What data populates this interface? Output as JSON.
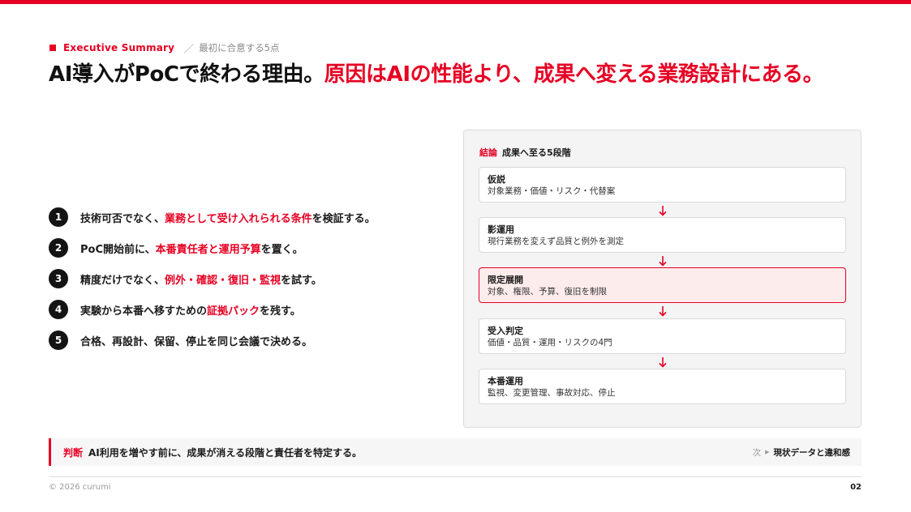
{
  "eyebrow": {
    "label": "Executive Summary",
    "separator": "／",
    "sub": "最初に合意する5点"
  },
  "title": {
    "plain": "AI導入がPoCで終わる理由。",
    "accent": "原因はAIの性能より、成果へ変える業務設計にある。"
  },
  "points": [
    {
      "num": "1",
      "pre": "技術可否でなく、",
      "hl": "業務として受け入れられる条件",
      "post": "を検証する。"
    },
    {
      "num": "2",
      "pre": "PoC開始前に、",
      "hl": "本番責任者と運用予算",
      "post": "を置く。"
    },
    {
      "num": "3",
      "pre": "精度だけでなく、",
      "hl": "例外・確認・復旧・監視",
      "post": "を試す。"
    },
    {
      "num": "4",
      "pre": "実験から本番へ移すための",
      "hl": "証拠パック",
      "post": "を残す。"
    },
    {
      "num": "5",
      "pre": "合格、再設計、保留、停止を同じ会議で決める。",
      "hl": "",
      "post": ""
    }
  ],
  "panel": {
    "tag": "結論",
    "title": "成果へ至る5段階",
    "steps": [
      {
        "name": "仮説",
        "desc": "対象業務・価値・リスク・代替案",
        "active": false
      },
      {
        "name": "影運用",
        "desc": "現行業務を変えず品質と例外を測定",
        "active": false
      },
      {
        "name": "限定展開",
        "desc": "対象、権限、予算、復旧を制限",
        "active": true
      },
      {
        "name": "受入判定",
        "desc": "価値・品質・運用・リスクの4門",
        "active": false
      },
      {
        "name": "本番運用",
        "desc": "監視、変更管理、事故対応、停止",
        "active": false
      }
    ]
  },
  "decision": {
    "tag": "判断",
    "text": "AI利用を増やす前に、成果が消える段階と責任者を特定する。",
    "next_label": "次",
    "next_text": "現状データと違和感"
  },
  "footer": {
    "copyright": "© 2026 curumi",
    "page": "02"
  },
  "colors": {
    "accent": "#e60023",
    "text": "#1a1a1a",
    "panel_bg": "#f4f4f5",
    "active_step_bg": "#fdecec"
  }
}
